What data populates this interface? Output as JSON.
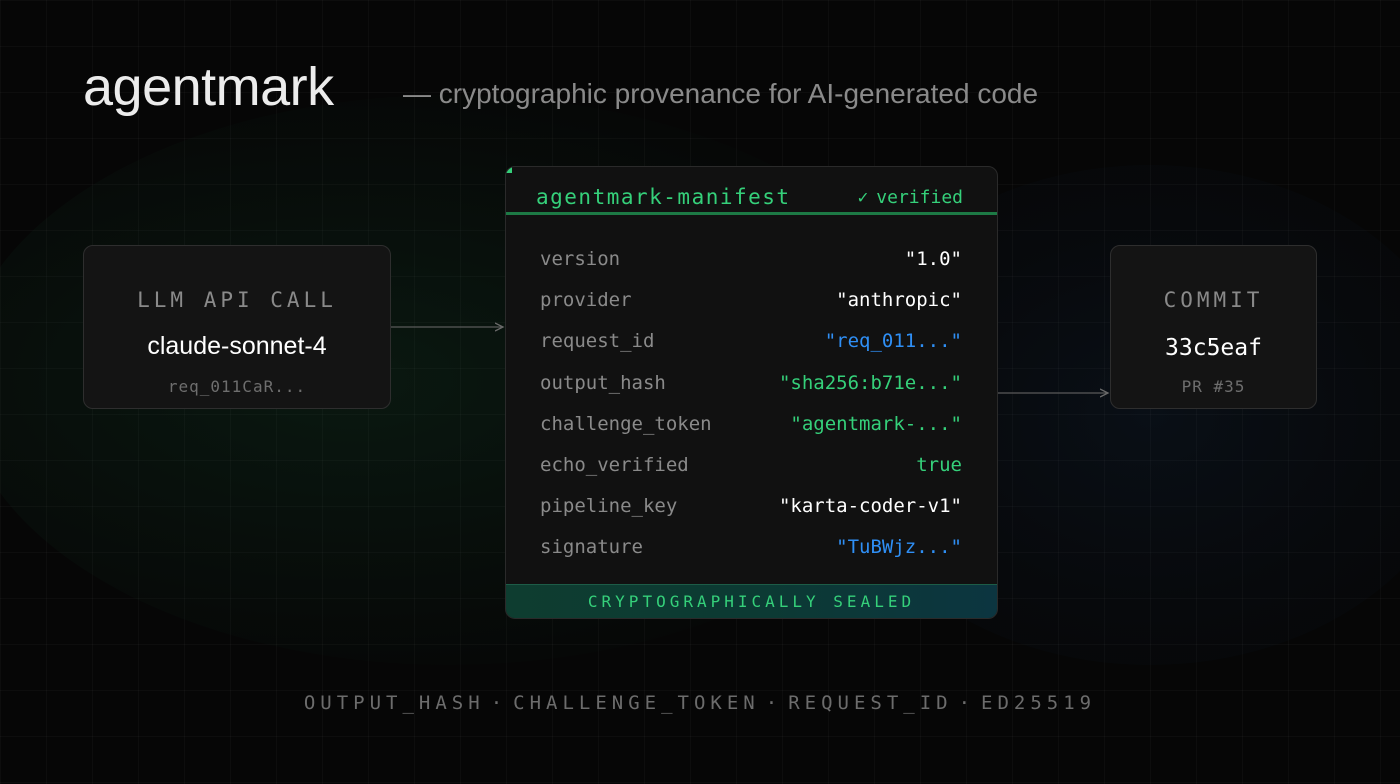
{
  "header": {
    "title": "agentmark",
    "subtitle": "— cryptographic provenance for AI-generated code"
  },
  "llm_box": {
    "label": "LLM API CALL",
    "model": "claude-sonnet-4",
    "request": "req_011CaR..."
  },
  "commit_box": {
    "label": "COMMIT",
    "hash": "33c5eaf",
    "pr": "PR #35"
  },
  "manifest": {
    "title": "agentmark-manifest",
    "status_icon": "check-icon",
    "status": "verified",
    "fields": [
      {
        "key": "version",
        "value": "\"1.0\"",
        "color": "#ffffff"
      },
      {
        "key": "provider",
        "value": "\"anthropic\"",
        "color": "#ffffff"
      },
      {
        "key": "request_id",
        "value": "\"req_011...\"",
        "color": "#2f8ff5"
      },
      {
        "key": "output_hash",
        "value": "\"sha256:b71e...\"",
        "color": "#35d07a"
      },
      {
        "key": "challenge_token",
        "value": "\"agentmark-...\"",
        "color": "#35d07a"
      },
      {
        "key": "echo_verified",
        "value": "true",
        "color": "#35d07a"
      },
      {
        "key": "pipeline_key",
        "value": "\"karta-coder-v1\"",
        "color": "#ffffff"
      },
      {
        "key": "signature",
        "value": "\"TuBWjz...\"",
        "color": "#2f8ff5"
      }
    ],
    "sealed_label": "CRYPTOGRAPHICALLY SEALED"
  },
  "footer": {
    "items": [
      "OUTPUT_HASH",
      "CHALLENGE_TOKEN",
      "REQUEST_ID",
      "ED25519"
    ],
    "separator": "·"
  },
  "colors": {
    "accent_green": "#35d07a",
    "accent_blue": "#2f8ff5",
    "background": "#060606"
  }
}
